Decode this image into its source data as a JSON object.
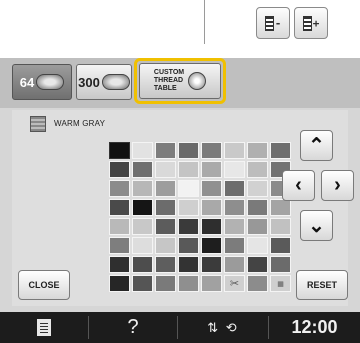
{
  "top_buttons": [
    {
      "label": "-",
      "name": "thread-minus-button"
    },
    {
      "label": "+",
      "name": "thread-plus-button"
    }
  ],
  "tabs": [
    {
      "num": "64",
      "active": true
    },
    {
      "num": "300",
      "active": false
    }
  ],
  "custom_tab": {
    "lines": "CUSTOM\nTHREAD\nTABLE"
  },
  "color_name": "WARM GRAY",
  "palette": [
    [
      "#111111",
      "#e2e2e2",
      "#7d7d7d",
      "#6a6a6a",
      "#7b7b7b",
      "#c9c9c9",
      "#b0b0b0",
      "#6e6e6e"
    ],
    [
      "#444444",
      "#6f6f6f",
      "#d9d9d9",
      "#c4c4c4",
      "#aaaaaa",
      "#e7e7e7",
      "#bdbdbd",
      "#727272"
    ],
    [
      "#8b8b8b",
      "#b7b7b7",
      "#9d9d9d",
      "#f2f2f2",
      "#909090",
      "#6d6d6d",
      "#d1d1d1",
      "#8a8a8a"
    ],
    [
      "#4a4a4a",
      "#151515",
      "#6c6c6c",
      "#cfcfcf",
      "#a9a9a9",
      "#8e8e8e",
      "#7a7a7a",
      "#a4a4a4"
    ],
    [
      "#b9b9b9",
      "#c8c8c8",
      "#5c5c5c",
      "#3a3a3a",
      "#2e2e2e",
      "#b2b2b2",
      "#989898",
      "#c1c1c1"
    ],
    [
      "#7e7e7e",
      "#dddddd",
      "#c6c6c6",
      "#595959",
      "#1e1e1e",
      "#7c7c7c",
      "#e5e5e5",
      "#5a5a5a"
    ],
    [
      "#2f2f2f",
      "#4d4d4d",
      "#5e5e5e",
      "#333333",
      "#3b3b3b",
      "#9b9b9b",
      "#444444",
      "#6b6b6b"
    ],
    [
      "#262626",
      "#555555",
      "#7a7a7a",
      "#8f8f8f",
      "#a1a1a1",
      "scissors",
      "#8c8c8c",
      "hatch"
    ]
  ],
  "selected_cell": [
    0,
    0
  ],
  "arrows": {
    "up": "⌃",
    "left": "‹",
    "right": "›",
    "down": "⌄"
  },
  "buttons": {
    "close": "CLOSE",
    "reset": "RESET"
  },
  "bottom_bar": {
    "help": "?",
    "conn": "⇅ ⟲",
    "time": "12:00"
  }
}
